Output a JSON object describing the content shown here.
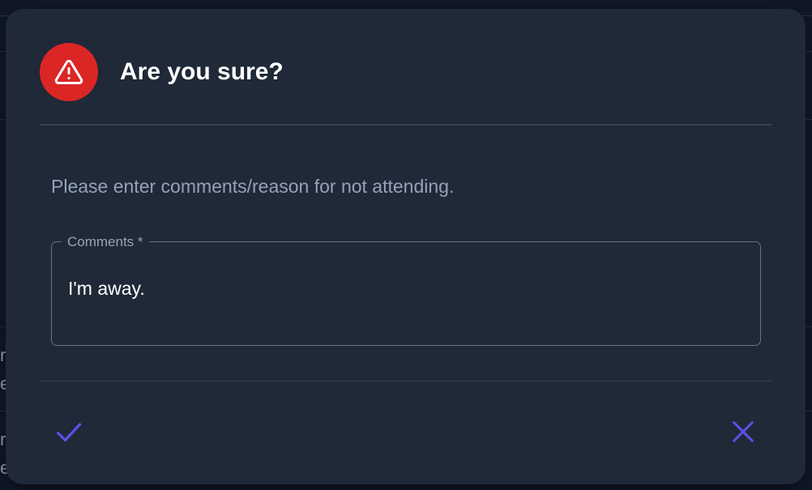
{
  "dialog": {
    "title": "Are you sure?",
    "prompt": "Please enter comments/reason for not attending.",
    "comments_field": {
      "label": "Comments *",
      "value": "I'm away."
    },
    "icons": {
      "header": "warning-triangle-icon",
      "confirm": "check-icon",
      "cancel": "close-icon"
    }
  },
  "background": {
    "row_1": {
      "line_1": "r",
      "line_2": "e"
    },
    "row_2": {
      "line_1": "r",
      "line_2": "e"
    }
  },
  "colors": {
    "dialog_bg": "#1f2937",
    "page_bg": "#111827",
    "warning": "#dc2626",
    "accent": "#5b50e6",
    "prompt_text": "#94a3b8"
  }
}
